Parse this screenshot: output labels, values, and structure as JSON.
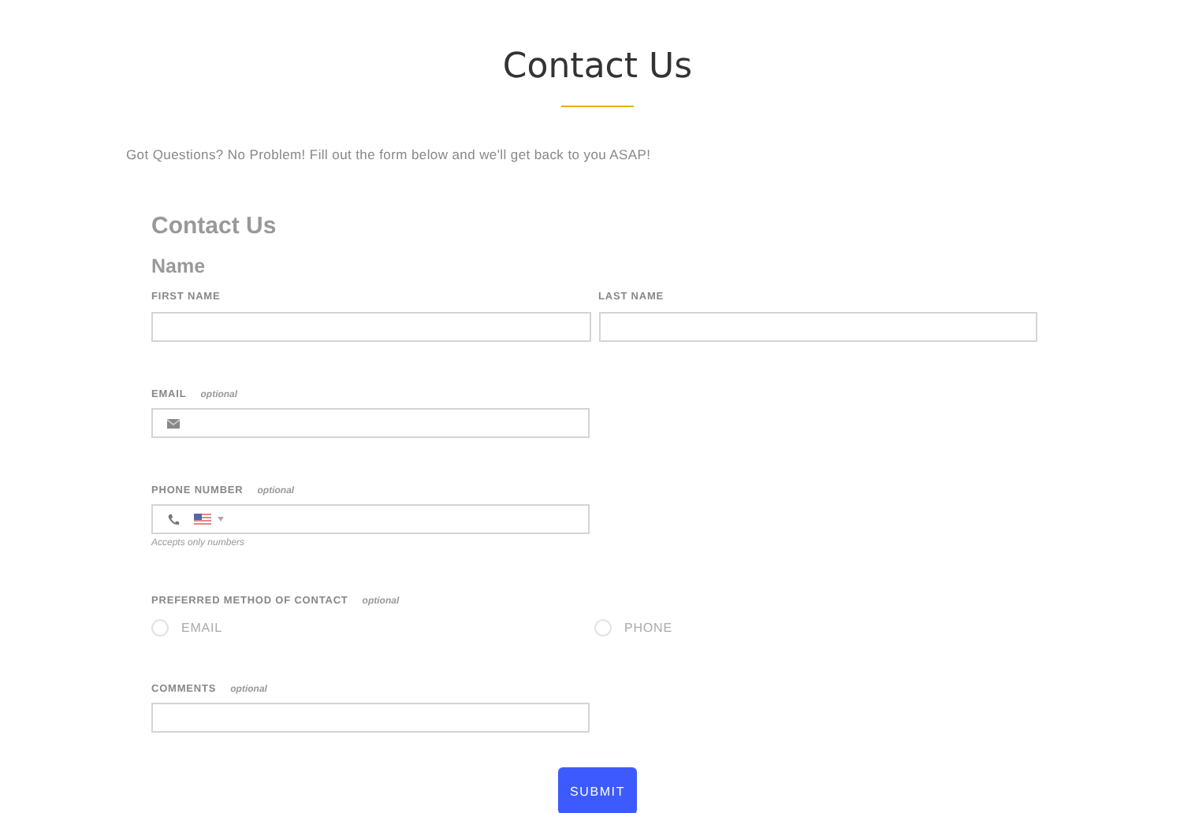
{
  "page": {
    "title": "Contact Us",
    "intro": "Got Questions? No Problem! Fill out the form below and we'll get back to you ASAP!"
  },
  "form": {
    "title": "Contact Us",
    "name_group": {
      "heading": "Name",
      "fields": [
        {
          "label": "FIRST NAME"
        },
        {
          "label": "LAST NAME"
        }
      ]
    },
    "email": {
      "label": "EMAIL",
      "note": "optional"
    },
    "phone": {
      "label": "PHONE NUMBER",
      "note": "optional",
      "hint": "Accepts only numbers"
    },
    "contact_method": {
      "label": "PREFERRED METHOD OF CONTACT",
      "note": "optional",
      "options": [
        {
          "label": "EMAIL",
          "selected": false
        },
        {
          "label": "PHONE",
          "selected": false
        }
      ]
    },
    "comments": {
      "label": "COMMENTS",
      "note": "optional"
    },
    "submit": "SUBMIT"
  }
}
